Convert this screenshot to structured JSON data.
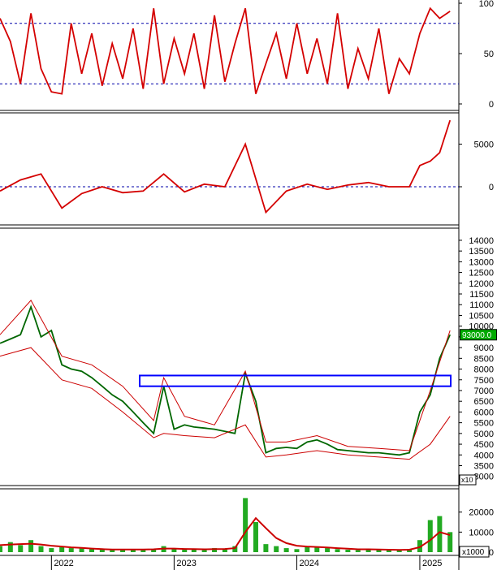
{
  "chart_data": [
    {
      "type": "line",
      "panel": "oscillator-1",
      "yticks": [
        0,
        50,
        100
      ],
      "ylim": [
        0,
        100
      ],
      "reference_lines": [
        20,
        80
      ],
      "series": [
        {
          "color": "#d40000",
          "x": [
            "2021-08",
            "2021-09",
            "2021-10",
            "2021-11",
            "2021-12",
            "2022-01",
            "2022-02",
            "2022-03",
            "2022-04",
            "2022-05",
            "2022-06",
            "2022-07",
            "2022-08",
            "2022-09",
            "2022-10",
            "2022-11",
            "2022-12",
            "2023-01",
            "2023-02",
            "2023-03",
            "2023-04",
            "2023-05",
            "2023-06",
            "2023-07",
            "2023-08",
            "2023-09",
            "2023-10",
            "2023-11",
            "2023-12",
            "2024-01",
            "2024-02",
            "2024-03",
            "2024-04",
            "2024-05",
            "2024-06",
            "2024-07",
            "2024-08",
            "2024-09",
            "2024-10",
            "2024-11",
            "2024-12",
            "2025-01",
            "2025-02",
            "2025-03",
            "2025-04"
          ],
          "values": [
            85,
            62,
            20,
            90,
            35,
            12,
            10,
            80,
            30,
            70,
            18,
            60,
            25,
            75,
            15,
            95,
            20,
            65,
            30,
            70,
            15,
            88,
            22,
            60,
            95,
            10,
            40,
            70,
            25,
            80,
            30,
            65,
            20,
            90,
            15,
            55,
            25,
            75,
            10,
            45,
            30,
            70,
            95,
            85,
            92
          ]
        }
      ]
    },
    {
      "type": "line",
      "panel": "oscillator-2",
      "yticks": [
        0,
        5000
      ],
      "ylim": [
        -4000,
        8000
      ],
      "reference_lines": [
        0
      ],
      "series": [
        {
          "color": "#d40000",
          "x": [
            "2021-08",
            "2021-10",
            "2021-12",
            "2022-02",
            "2022-04",
            "2022-06",
            "2022-08",
            "2022-10",
            "2022-12",
            "2023-02",
            "2023-04",
            "2023-06",
            "2023-08",
            "2023-10",
            "2023-12",
            "2024-02",
            "2024-04",
            "2024-06",
            "2024-08",
            "2024-10",
            "2024-12",
            "2025-01",
            "2025-02",
            "2025-03",
            "2025-04"
          ],
          "values": [
            -500,
            800,
            1500,
            -2500,
            -800,
            0,
            -700,
            -500,
            1500,
            -600,
            300,
            0,
            5000,
            -3000,
            -500,
            300,
            -300,
            200,
            500,
            0,
            0,
            2500,
            3000,
            4000,
            7800
          ]
        }
      ]
    },
    {
      "type": "line",
      "panel": "price",
      "yticks": [
        3000,
        3500,
        4000,
        4500,
        5000,
        5500,
        6000,
        6500,
        7000,
        7500,
        8000,
        8500,
        9000,
        9500,
        10000,
        10500,
        11000,
        11500,
        12000,
        12500,
        13000,
        13500,
        14000
      ],
      "ylim": [
        2800,
        14300
      ],
      "last_price_label": "93000.0",
      "highlight_zone": [
        7200,
        7700
      ],
      "series": [
        {
          "name": "close",
          "color": "#006600",
          "x": [
            "2021-08",
            "2021-09",
            "2021-10",
            "2021-11",
            "2021-12",
            "2022-01",
            "2022-02",
            "2022-03",
            "2022-04",
            "2022-05",
            "2022-06",
            "2022-07",
            "2022-08",
            "2022-09",
            "2022-10",
            "2022-11",
            "2022-12",
            "2023-01",
            "2023-02",
            "2023-03",
            "2023-04",
            "2023-05",
            "2023-06",
            "2023-07",
            "2023-08",
            "2023-09",
            "2023-10",
            "2023-11",
            "2023-12",
            "2024-01",
            "2024-02",
            "2024-03",
            "2024-04",
            "2024-05",
            "2024-06",
            "2024-07",
            "2024-08",
            "2024-09",
            "2024-10",
            "2024-11",
            "2024-12",
            "2025-01",
            "2025-02",
            "2025-03",
            "2025-04"
          ],
          "values": [
            9200,
            9400,
            9600,
            10900,
            9500,
            9800,
            8200,
            8000,
            7900,
            7600,
            7200,
            6800,
            6500,
            6000,
            5500,
            5000,
            7200,
            5200,
            5400,
            5300,
            5250,
            5200,
            5100,
            5000,
            7800,
            6500,
            4100,
            4300,
            4350,
            4300,
            4600,
            4700,
            4500,
            4250,
            4200,
            4150,
            4100,
            4100,
            4050,
            4000,
            4100,
            6000,
            6800,
            8500,
            9600
          ]
        },
        {
          "name": "band-upper",
          "color": "#cc0000",
          "x": [
            "2021-08",
            "2021-11",
            "2022-02",
            "2022-05",
            "2022-08",
            "2022-11",
            "2022-12",
            "2023-02",
            "2023-05",
            "2023-08",
            "2023-10",
            "2023-12",
            "2024-03",
            "2024-06",
            "2024-09",
            "2024-12",
            "2025-02",
            "2025-04"
          ],
          "values": [
            9600,
            11200,
            8600,
            8200,
            7200,
            5600,
            7600,
            5800,
            5400,
            7900,
            4600,
            4600,
            4900,
            4400,
            4300,
            4200,
            7000,
            9800
          ]
        },
        {
          "name": "band-lower",
          "color": "#cc0000",
          "x": [
            "2021-08",
            "2021-11",
            "2022-02",
            "2022-05",
            "2022-08",
            "2022-11",
            "2022-12",
            "2023-02",
            "2023-05",
            "2023-08",
            "2023-10",
            "2023-12",
            "2024-03",
            "2024-06",
            "2024-09",
            "2024-12",
            "2025-02",
            "2025-04"
          ],
          "values": [
            8600,
            9000,
            7500,
            7100,
            6000,
            4800,
            5000,
            4900,
            4800,
            5400,
            3900,
            4000,
            4200,
            4000,
            3900,
            3800,
            4500,
            5800
          ]
        }
      ]
    },
    {
      "type": "bar",
      "panel": "volume",
      "yticks": [
        0,
        10000,
        20000
      ],
      "ylim": [
        0,
        30000
      ],
      "unit_label": "x1000",
      "x_ticks": [
        "2022",
        "2023",
        "2024",
        "2025"
      ],
      "x": [
        "2021-08",
        "2021-09",
        "2021-10",
        "2021-11",
        "2021-12",
        "2022-01",
        "2022-02",
        "2022-03",
        "2022-04",
        "2022-05",
        "2022-06",
        "2022-07",
        "2022-08",
        "2022-09",
        "2022-10",
        "2022-11",
        "2022-12",
        "2023-01",
        "2023-02",
        "2023-03",
        "2023-04",
        "2023-05",
        "2023-06",
        "2023-07",
        "2023-08",
        "2023-09",
        "2023-10",
        "2023-11",
        "2023-12",
        "2024-01",
        "2024-02",
        "2024-03",
        "2024-04",
        "2024-05",
        "2024-06",
        "2024-07",
        "2024-08",
        "2024-09",
        "2024-10",
        "2024-11",
        "2024-12",
        "2025-01",
        "2025-02",
        "2025-03",
        "2025-04"
      ],
      "values": [
        3000,
        5000,
        3500,
        6000,
        3000,
        2000,
        2500,
        2000,
        1800,
        1500,
        1200,
        1000,
        1200,
        1500,
        1000,
        1500,
        3000,
        1500,
        1200,
        1500,
        1000,
        2000,
        1800,
        3000,
        27000,
        15000,
        4000,
        3000,
        2000,
        1500,
        3000,
        2500,
        2000,
        1500,
        1200,
        1000,
        1500,
        1200,
        1000,
        1000,
        1500,
        6000,
        16000,
        18000,
        10000
      ],
      "ma": [
        3500,
        3800,
        4000,
        4200,
        3800,
        3200,
        2800,
        2400,
        2100,
        1800,
        1500,
        1300,
        1300,
        1300,
        1300,
        1400,
        1800,
        1800,
        1600,
        1500,
        1400,
        1500,
        1600,
        2000,
        10000,
        17000,
        12000,
        7000,
        4500,
        3200,
        2800,
        2600,
        2300,
        2000,
        1700,
        1400,
        1400,
        1300,
        1200,
        1100,
        1200,
        2500,
        6000,
        10000,
        8500
      ]
    }
  ]
}
